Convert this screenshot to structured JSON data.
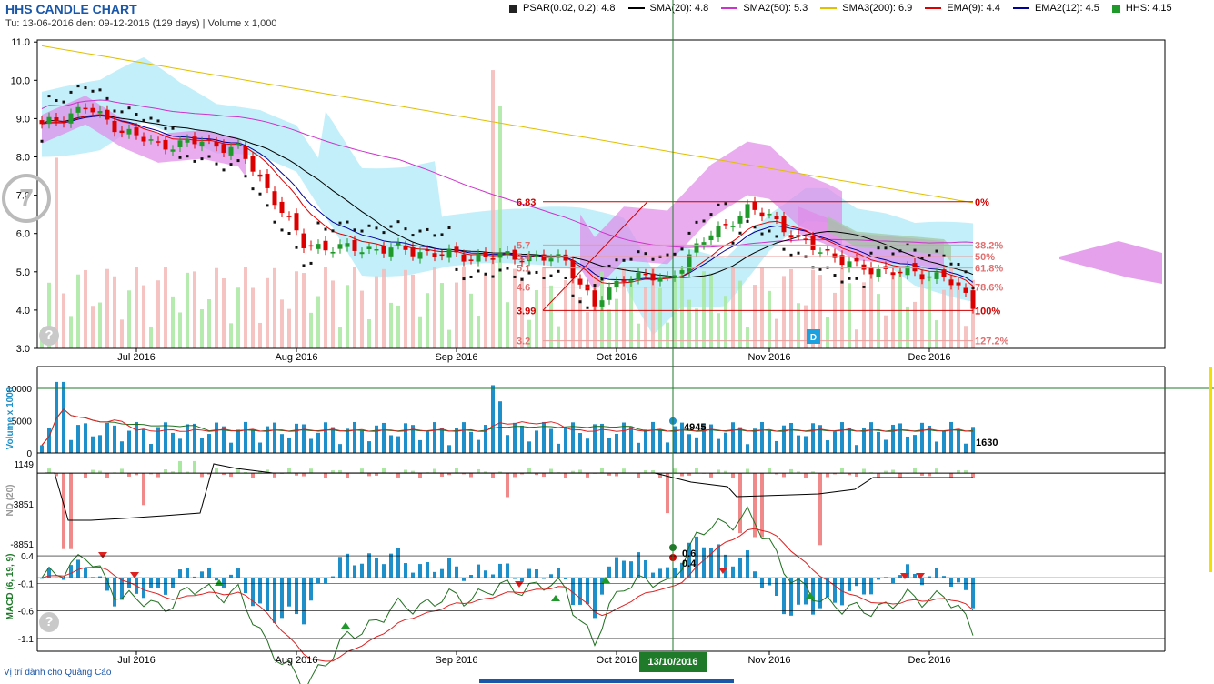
{
  "title": "HHS CANDLE CHART",
  "subtitle": "Tu: 13-06-2016 den: 09-12-2016 (129 days) | Volume x 1,000",
  "legend": [
    {
      "label": "PSAR(0.02, 0.2): 4.8",
      "color": "#222222",
      "kind": "square"
    },
    {
      "label": "SMA(20): 4.8",
      "color": "#000000",
      "kind": "line"
    },
    {
      "label": "SMA2(50): 5.3",
      "color": "#cc33cc",
      "kind": "line"
    },
    {
      "label": "SMA3(200): 6.9",
      "color": "#e0c000",
      "kind": "line"
    },
    {
      "label": "EMA(9): 4.4",
      "color": "#dd0000",
      "kind": "line"
    },
    {
      "label": "EMA2(12): 4.5",
      "color": "#000099",
      "kind": "line"
    },
    {
      "label": "HHS: 4.15",
      "color": "#1f9a2a",
      "kind": "square"
    }
  ],
  "price_axis": [
    "3.0",
    "4.0",
    "5.0",
    "6.0",
    "7.0",
    "8.0",
    "9.0",
    "10.0",
    "11.0"
  ],
  "month_labels": [
    "Jul 2016",
    "Aug 2016",
    "Sep 2016",
    "Oct 2016",
    "Nov 2016",
    "Dec 2016"
  ],
  "fib_levels": [
    {
      "price": 6.83,
      "label": "0%"
    },
    {
      "price": 5.7,
      "label": "38.2%"
    },
    {
      "price": 5.4,
      "label": "50%"
    },
    {
      "price": 5.1,
      "label": "61.8%"
    },
    {
      "price": 4.6,
      "label": "78.6%"
    },
    {
      "price": 3.99,
      "label": "100%"
    },
    {
      "price": 3.2,
      "label": "127.2%"
    }
  ],
  "fib_price_labels": [
    "6.83",
    "5.7",
    "5.4",
    "5.1",
    "4.6",
    "3.99",
    "3.2"
  ],
  "volume_axis": [
    "10000",
    "5000",
    "0"
  ],
  "volume_label": "Volume x 1000",
  "volume_marker_value": "4945",
  "volume_last_value": "1630",
  "nd_axis": [
    "1149",
    "-3851",
    "-8851"
  ],
  "nd_label": "ND (20)",
  "macd_axis": [
    "0.4",
    "-0.1",
    "-0.6",
    "-1.1"
  ],
  "macd_label": "MACD (6, 19, 9)",
  "macd_marker_values": [
    "0.6",
    "0.4"
  ],
  "crosshair_date": "13/10/2016",
  "d_marker": "D",
  "zoom_symbol": "7",
  "help_symbol": "?",
  "ad_text": "Vị trí dành cho Quảng Cáo",
  "chart_data": {
    "type": "candlestick",
    "title": "HHS CANDLE CHART",
    "period": "13-06-2016 to 09-12-2016",
    "days": 129,
    "ylim": [
      3.0,
      11.0
    ],
    "close_anchors": [
      {
        "day": 0,
        "value": 8.8
      },
      {
        "day": 6,
        "value": 9.3
      },
      {
        "day": 11,
        "value": 8.7
      },
      {
        "day": 16,
        "value": 8.3
      },
      {
        "day": 22,
        "value": 8.4
      },
      {
        "day": 27,
        "value": 8.2
      },
      {
        "day": 32,
        "value": 6.9
      },
      {
        "day": 36,
        "value": 5.7
      },
      {
        "day": 42,
        "value": 5.6
      },
      {
        "day": 48,
        "value": 5.6
      },
      {
        "day": 58,
        "value": 5.4
      },
      {
        "day": 66,
        "value": 5.4
      },
      {
        "day": 72,
        "value": 5.3
      },
      {
        "day": 76,
        "value": 4.1
      },
      {
        "day": 80,
        "value": 4.9
      },
      {
        "day": 86,
        "value": 4.8
      },
      {
        "day": 92,
        "value": 6.0
      },
      {
        "day": 97,
        "value": 6.6
      },
      {
        "day": 100,
        "value": 6.5
      },
      {
        "day": 104,
        "value": 5.8
      },
      {
        "day": 108,
        "value": 5.5
      },
      {
        "day": 112,
        "value": 5.1
      },
      {
        "day": 118,
        "value": 5.0
      },
      {
        "day": 124,
        "value": 4.9
      },
      {
        "day": 128,
        "value": 4.15
      }
    ],
    "last": {
      "psar": 4.8,
      "sma20": 4.8,
      "sma50": 5.3,
      "sma200": 6.9,
      "ema9": 4.4,
      "ema12": 4.5,
      "close": 4.15
    },
    "volume_x1000": {
      "marker": 4945,
      "last": 1630,
      "axis_ticks": [
        0,
        5000,
        10000
      ]
    },
    "macd": {
      "params": [
        6,
        19,
        9
      ],
      "marker_values": [
        0.6,
        0.4
      ],
      "axis_ticks": [
        -1.1,
        -0.6,
        -0.1,
        0.4
      ]
    },
    "nd20": {
      "axis_ticks": [
        -8851,
        -3851,
        1149
      ]
    }
  }
}
